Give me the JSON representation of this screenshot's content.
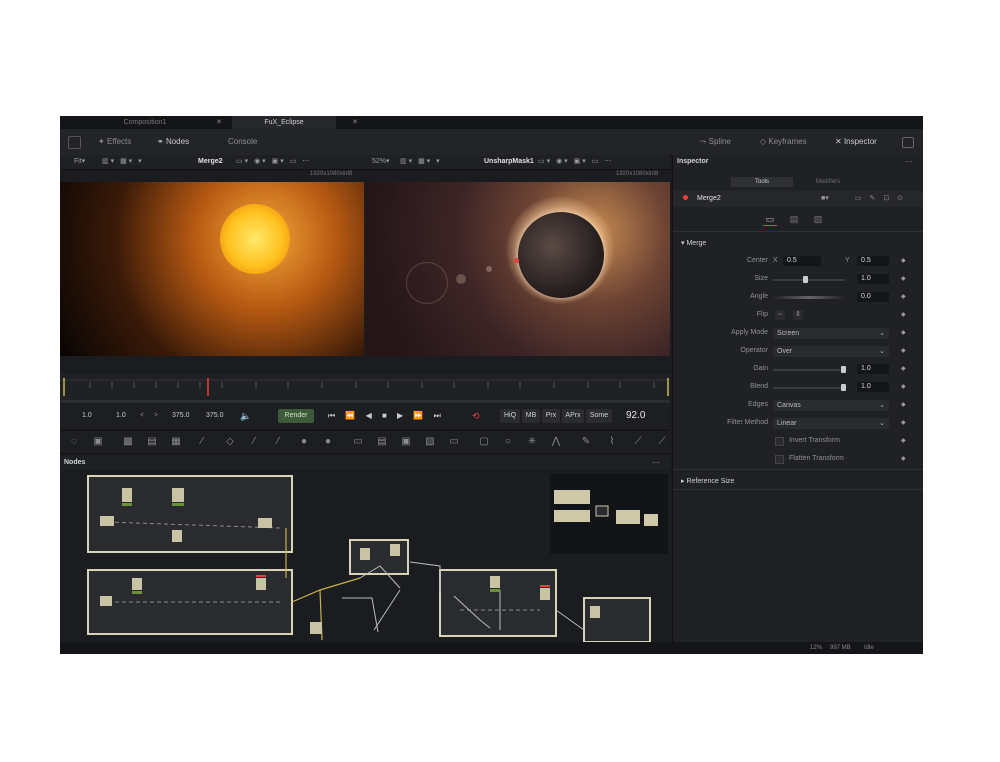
{
  "tabs": [
    {
      "label": "Composition1",
      "active": false
    },
    {
      "label": "FuX_Eclipse",
      "active": true
    }
  ],
  "toolbar": {
    "effects": "Effects",
    "nodes": "Nodes",
    "console": "Console",
    "spline": "Spline",
    "keyframes": "Keyframes",
    "inspector": "Inspector"
  },
  "viewer_left": {
    "fit": "Fit",
    "node": "Merge2",
    "resolution": "1920x1080xint8"
  },
  "viewer_right": {
    "zoom": "52%",
    "node": "UnsharpMask1",
    "resolution": "1920x1080xint8"
  },
  "transport": {
    "start": "1.0",
    "render_start": "1.0",
    "render_end": "375.0",
    "end": "375.0",
    "render_button": "Render",
    "hiq": "HiQ",
    "mb": "MB",
    "prx": "Prx",
    "aprx": "APrx",
    "some": "Some",
    "current_frame": "92.0"
  },
  "nodes_panel": {
    "title": "Nodes"
  },
  "inspector": {
    "title": "Inspector",
    "tabs": [
      "Tools",
      "Modifiers"
    ],
    "node_name": "Merge2",
    "section_merge": "Merge",
    "center_label": "Center",
    "center_x_label": "X",
    "center_x": "0.5",
    "center_y_label": "Y",
    "center_y": "0.5",
    "size_label": "Size",
    "size": "1.0",
    "angle_label": "Angle",
    "angle": "0.0",
    "flip_label": "Flip",
    "apply_mode_label": "Apply Mode",
    "apply_mode": "Screen",
    "operator_label": "Operator",
    "operator": "Over",
    "gain_label": "Gain",
    "gain": "1.0",
    "blend_label": "Blend",
    "blend": "1.0",
    "edges_label": "Edges",
    "edges": "Canvas",
    "filter_label": "Filter Method",
    "filter": "Linear",
    "invert_transform": "Invert Transform",
    "flatten_transform": "Flatten Transform",
    "section_reference": "Reference Size"
  },
  "status": {
    "zoom": "12%",
    "memory": "997 MB",
    "state": "Idle"
  },
  "colors": {
    "accent": "#e6423a",
    "background": "#1b1c1f",
    "render_button": "#3d5a3a"
  }
}
